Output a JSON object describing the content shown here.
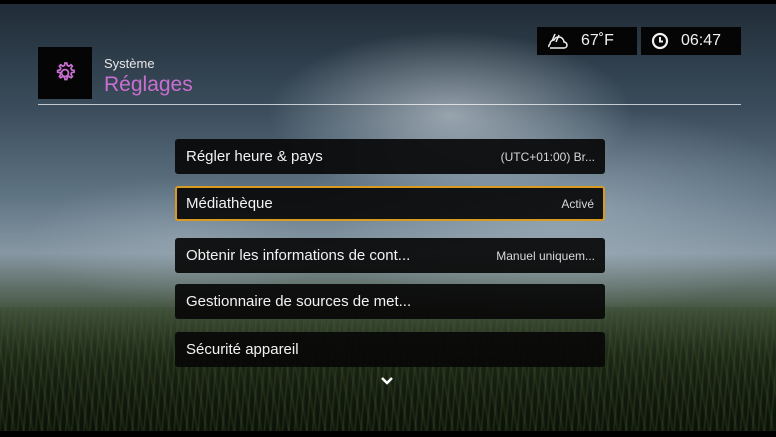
{
  "header": {
    "subtitle": "Système",
    "title": "Réglages",
    "app_icon": "gear-icon"
  },
  "status_bar": {
    "weather_icon": "weather-cloud-icon",
    "temperature": "67˚F",
    "clock_icon": "clock-icon",
    "time": "06:47"
  },
  "menu": {
    "items": [
      {
        "label": "Régler heure & pays",
        "value": "(UTC+01:00) Br..."
      },
      {
        "label": "Médiathèque",
        "value": "Activé",
        "selected": true
      },
      {
        "label": "Obtenir les informations de cont...",
        "value": "Manuel uniquem..."
      },
      {
        "label": "Gestionnaire de sources de met...",
        "value": ""
      },
      {
        "label": "Sécurité appareil",
        "value": ""
      }
    ],
    "more_icon": "chevron-down-icon"
  },
  "colors": {
    "accent": "#c86fd1",
    "selection_border": "#d99a22",
    "panel_bg": "#080808"
  }
}
